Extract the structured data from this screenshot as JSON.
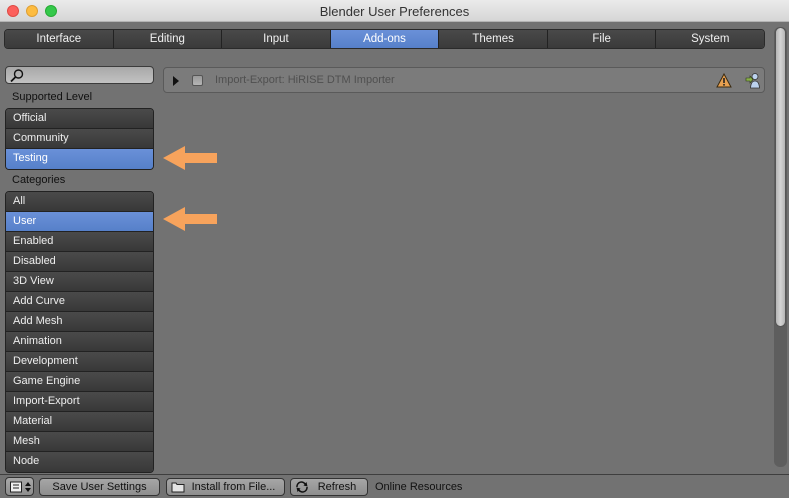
{
  "window": {
    "title": "Blender User Preferences"
  },
  "tabs": [
    {
      "label": "Interface",
      "active": false
    },
    {
      "label": "Editing",
      "active": false
    },
    {
      "label": "Input",
      "active": false
    },
    {
      "label": "Add-ons",
      "active": true
    },
    {
      "label": "Themes",
      "active": false
    },
    {
      "label": "File",
      "active": false
    },
    {
      "label": "System",
      "active": false
    }
  ],
  "sidebar": {
    "search_placeholder": "",
    "supported_level_label": "Supported Level",
    "supported_levels": [
      {
        "label": "Official",
        "selected": false
      },
      {
        "label": "Community",
        "selected": false
      },
      {
        "label": "Testing",
        "selected": true
      }
    ],
    "categories_label": "Categories",
    "categories": [
      {
        "label": "All",
        "selected": false
      },
      {
        "label": "User",
        "selected": true
      },
      {
        "label": "Enabled",
        "selected": false
      },
      {
        "label": "Disabled",
        "selected": false
      },
      {
        "label": "3D View",
        "selected": false
      },
      {
        "label": "Add Curve",
        "selected": false
      },
      {
        "label": "Add Mesh",
        "selected": false
      },
      {
        "label": "Animation",
        "selected": false
      },
      {
        "label": "Development",
        "selected": false
      },
      {
        "label": "Game Engine",
        "selected": false
      },
      {
        "label": "Import-Export",
        "selected": false
      },
      {
        "label": "Material",
        "selected": false
      },
      {
        "label": "Mesh",
        "selected": false
      },
      {
        "label": "Node",
        "selected": false
      }
    ]
  },
  "addons": [
    {
      "name": "Import-Export: HiRISE DTM Importer",
      "enabled": false,
      "icons": [
        "warning-icon",
        "user-addon-icon"
      ]
    }
  ],
  "bottombar": {
    "save_label": "Save User Settings",
    "install_label": "Install from File...",
    "refresh_label": "Refresh",
    "online_label": "Online Resources"
  },
  "colors": {
    "accent": "#5680c9",
    "annotation_arrow": "#f7a35c"
  }
}
